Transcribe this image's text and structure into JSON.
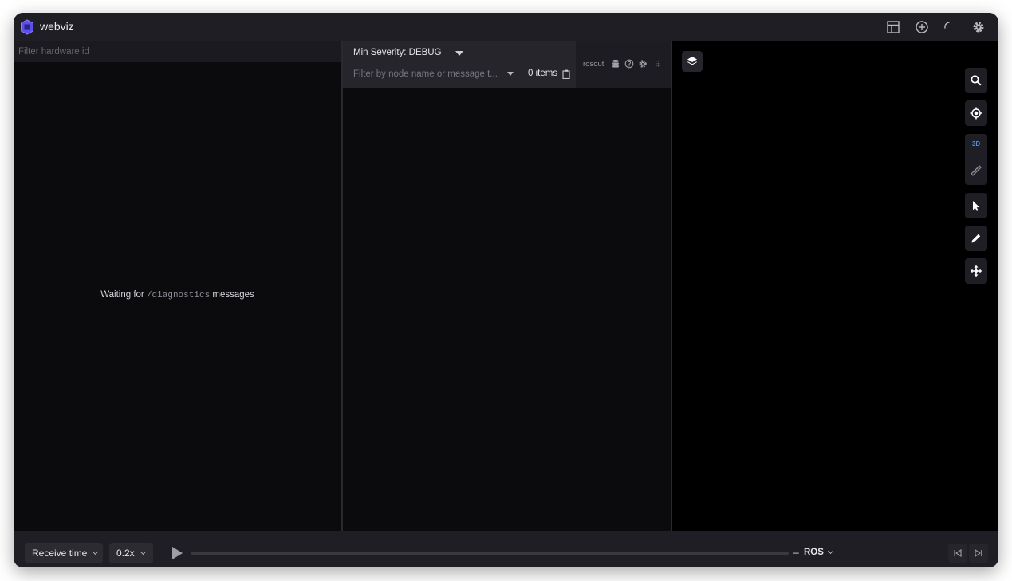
{
  "app": {
    "title": "webviz"
  },
  "diagnostics": {
    "filter_placeholder": "Filter hardware id",
    "waiting_prefix": "Waiting for",
    "waiting_topic": "/diagnostics",
    "waiting_suffix": "messages"
  },
  "rosout": {
    "severity_label": "Min Severity: DEBUG",
    "filter_placeholder": "Filter by node name or message t...",
    "items_count": "0 items",
    "topic": "rosout"
  },
  "viewer3d": {
    "mode_label": "3D"
  },
  "playback": {
    "time_mode": "Receive time",
    "speed": "0.2x",
    "separator": "–",
    "data_source": "ROS"
  },
  "colors": {
    "accent": "#4e8de8",
    "logo": "#6b5cf0"
  }
}
